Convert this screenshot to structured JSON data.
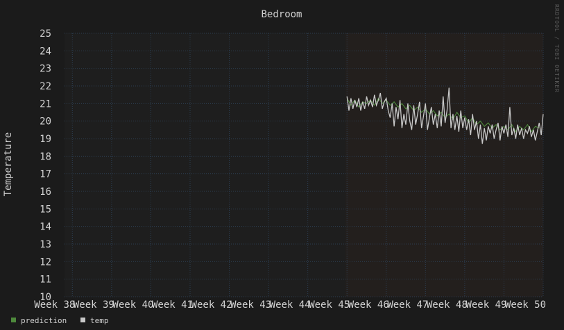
{
  "chart_data": {
    "type": "line",
    "title": "Bedroom",
    "ylabel": "Temperature",
    "xlabel": "",
    "ylim": [
      10,
      25
    ],
    "yticks": [
      10,
      11,
      12,
      13,
      14,
      15,
      16,
      17,
      18,
      19,
      20,
      21,
      22,
      23,
      24,
      25
    ],
    "x_range_weeks": [
      37.8,
      50.0
    ],
    "xtick_labels": [
      "Week 38",
      "Week 39",
      "Week 40",
      "Week 41",
      "Week 42",
      "Week 43",
      "Week 44",
      "Week 45",
      "Week 46",
      "Week 47",
      "Week 48",
      "Week 49",
      "Week 50"
    ],
    "xtick_weeks": [
      38,
      39,
      40,
      41,
      42,
      43,
      44,
      45,
      46,
      47,
      48,
      49,
      50
    ],
    "grid": true,
    "watermark": "RRDTOOL / TOBI OETIKER",
    "legend_position": "bottom-left",
    "colors": {
      "background": "#1b1b1b",
      "plot_background": "#1e1e1e",
      "data_region": "#231f1d",
      "grid": "#2c3e52",
      "prediction": "#4e8a3c",
      "temp": "#c8c8c8"
    },
    "series": [
      {
        "name": "prediction",
        "x": [
          45.0,
          45.1,
          45.2,
          45.3,
          45.4,
          45.5,
          45.6,
          45.7,
          45.8,
          45.9,
          46.0,
          46.1,
          46.2,
          46.3,
          46.4,
          46.5,
          46.6,
          46.7,
          46.8,
          46.9,
          47.0,
          47.1,
          47.2,
          47.3,
          47.4,
          47.5,
          47.6,
          47.7,
          47.8,
          47.9,
          48.0,
          48.1,
          48.2,
          48.3,
          48.4,
          48.5,
          48.6,
          48.7,
          48.8,
          48.9,
          49.0,
          49.1,
          49.2,
          49.3,
          49.4,
          49.5,
          49.6,
          49.7,
          49.8,
          49.9
        ],
        "values": [
          21.3,
          20.9,
          21.2,
          20.8,
          21.1,
          21.0,
          21.2,
          20.9,
          21.3,
          21.0,
          21.2,
          20.9,
          21.1,
          20.8,
          21.0,
          20.7,
          20.9,
          20.6,
          20.8,
          20.5,
          20.7,
          20.4,
          20.6,
          20.3,
          20.5,
          20.2,
          20.4,
          20.1,
          20.5,
          20.2,
          20.3,
          19.9,
          20.2,
          19.8,
          20.0,
          19.7,
          19.9,
          19.6,
          19.8,
          19.5,
          19.7,
          19.5,
          19.8,
          19.4,
          19.7,
          19.5,
          19.8,
          19.4,
          19.7,
          19.6
        ]
      },
      {
        "name": "temp",
        "x": [
          45.0,
          45.05,
          45.1,
          45.15,
          45.2,
          45.25,
          45.3,
          45.35,
          45.4,
          45.45,
          45.5,
          45.55,
          45.6,
          45.65,
          45.7,
          45.75,
          45.8,
          45.85,
          45.9,
          45.95,
          46.0,
          46.05,
          46.1,
          46.15,
          46.2,
          46.25,
          46.3,
          46.35,
          46.4,
          46.45,
          46.5,
          46.55,
          46.6,
          46.65,
          46.7,
          46.75,
          46.8,
          46.85,
          46.9,
          46.95,
          47.0,
          47.05,
          47.1,
          47.15,
          47.2,
          47.25,
          47.3,
          47.35,
          47.4,
          47.45,
          47.5,
          47.55,
          47.6,
          47.65,
          47.7,
          47.75,
          47.8,
          47.85,
          47.9,
          47.95,
          48.0,
          48.05,
          48.1,
          48.15,
          48.2,
          48.25,
          48.3,
          48.35,
          48.4,
          48.45,
          48.5,
          48.55,
          48.6,
          48.65,
          48.7,
          48.75,
          48.8,
          48.85,
          48.9,
          48.95,
          49.0,
          49.05,
          49.1,
          49.15,
          49.2,
          49.25,
          49.3,
          49.35,
          49.4,
          49.45,
          49.5,
          49.55,
          49.6,
          49.65,
          49.7,
          49.75,
          49.8,
          49.85,
          49.9,
          49.95,
          50.0
        ],
        "values": [
          21.4,
          20.6,
          21.3,
          20.7,
          21.2,
          20.8,
          21.3,
          20.6,
          21.1,
          20.7,
          21.4,
          20.9,
          21.2,
          20.8,
          21.5,
          20.9,
          21.2,
          21.6,
          20.7,
          21.1,
          21.3,
          20.6,
          20.2,
          21.0,
          19.7,
          20.8,
          20.1,
          21.2,
          19.6,
          20.4,
          19.8,
          21.0,
          20.0,
          19.5,
          20.9,
          19.8,
          20.4,
          21.1,
          19.6,
          20.3,
          21.0,
          19.5,
          20.2,
          20.8,
          19.8,
          20.4,
          19.6,
          20.6,
          19.7,
          21.4,
          19.9,
          20.6,
          21.9,
          19.6,
          20.4,
          19.5,
          20.3,
          19.4,
          20.6,
          19.6,
          20.2,
          19.5,
          20.1,
          19.2,
          20.4,
          19.5,
          20.0,
          19.0,
          19.8,
          18.7,
          19.6,
          18.9,
          19.7,
          19.3,
          19.8,
          19.0,
          19.5,
          19.9,
          18.9,
          19.7,
          19.3,
          19.8,
          19.1,
          20.8,
          19.2,
          19.6,
          19.0,
          19.8,
          19.2,
          19.6,
          19.0,
          19.5,
          19.3,
          19.7,
          19.1,
          19.5,
          18.9,
          19.4,
          19.9,
          19.2,
          20.4
        ]
      }
    ]
  }
}
